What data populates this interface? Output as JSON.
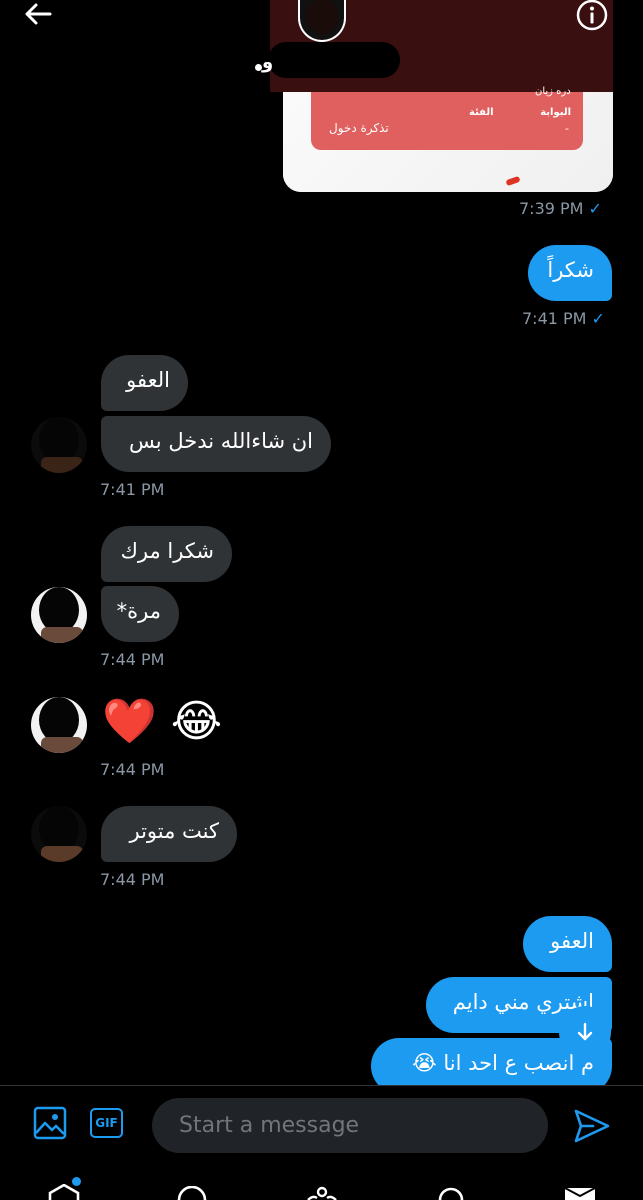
{
  "header": {
    "name_suffix": "و",
    "back_icon": "arrow-left-icon",
    "info_icon": "info-icon"
  },
  "shared_image": {
    "top_text": "دره زيان",
    "gate_label": "البوابة",
    "category_label": "الفئة",
    "gate_value": "-",
    "category_value": "تذكرة دخول",
    "time": "7:39 PM"
  },
  "messages": [
    {
      "id": "m1",
      "direction": "out",
      "text": "شكراً",
      "time": "7:41 PM"
    },
    {
      "id": "m2",
      "direction": "in",
      "text": "العفو"
    },
    {
      "id": "m3",
      "direction": "in",
      "text": "ان شاءالله ندخل بس",
      "time": "7:41 PM"
    },
    {
      "id": "m4",
      "direction": "in",
      "text": "شكرا مرك"
    },
    {
      "id": "m5",
      "direction": "in",
      "text": "مرة*",
      "time": "7:44 PM"
    },
    {
      "id": "m6",
      "direction": "in",
      "text": "❤️ 😂",
      "time": "7:44 PM"
    },
    {
      "id": "m7",
      "direction": "in",
      "text": "كنت متوتر",
      "time": "7:44 PM"
    },
    {
      "id": "m8",
      "direction": "out",
      "text": "العفو"
    },
    {
      "id": "m9",
      "direction": "out",
      "text": "اشتري مني دايم"
    },
    {
      "id": "m10",
      "direction": "out",
      "text": "م انصب ع احد انا 😭"
    }
  ],
  "composer": {
    "placeholder": "Start a message",
    "gif_label": "GIF",
    "media_icon": "image-icon",
    "send_icon": "send-icon"
  },
  "colors": {
    "accent": "#1d9bf0",
    "incoming_bubble": "#2f3336",
    "background": "#000000",
    "timestamp": "#8b98a5"
  }
}
